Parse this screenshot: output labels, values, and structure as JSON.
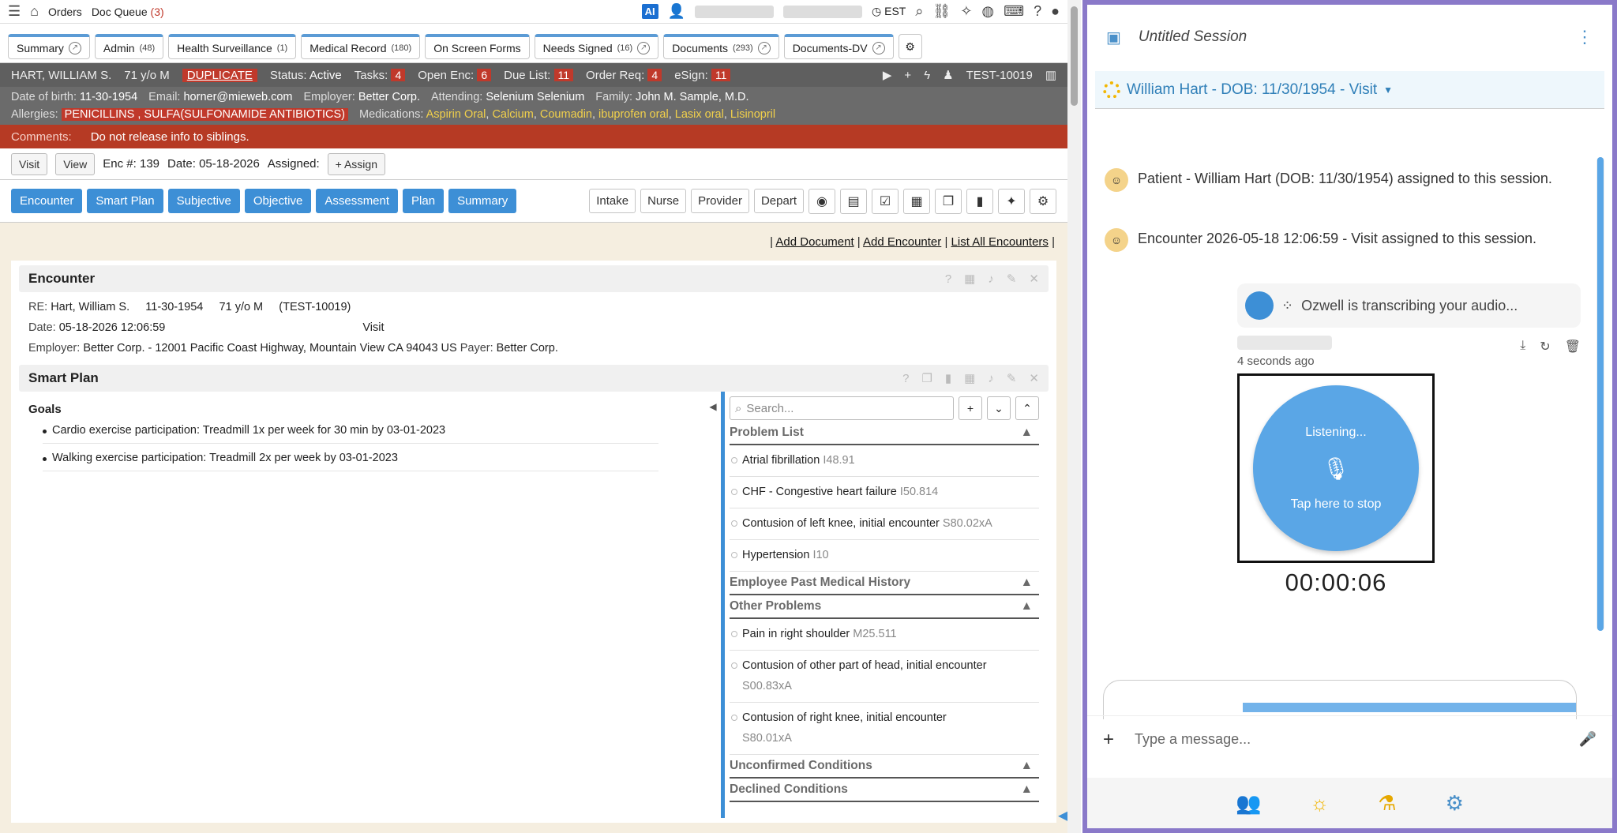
{
  "topbar": {
    "orders": "Orders",
    "doc_queue": "Doc Queue",
    "doc_queue_count": "(3)",
    "ai": "AI",
    "tz": "EST"
  },
  "tabs": [
    {
      "label": "Summary",
      "count": ""
    },
    {
      "label": "Admin",
      "count": "(48)"
    },
    {
      "label": "Health Surveillance",
      "count": "(1)"
    },
    {
      "label": "Medical Record",
      "count": "(180)"
    },
    {
      "label": "On Screen Forms",
      "count": ""
    },
    {
      "label": "Needs Signed",
      "count": "(16)"
    },
    {
      "label": "Documents",
      "count": "(293)"
    },
    {
      "label": "Documents-DV",
      "count": ""
    }
  ],
  "patient": {
    "name": "HART, WILLIAM S.",
    "age": "71 y/o M",
    "duplicate": "DUPLICATE",
    "status_lbl": "Status:",
    "status": "Active",
    "tasks_lbl": "Tasks:",
    "tasks": "4",
    "openenc_lbl": "Open Enc:",
    "openenc": "6",
    "due_lbl": "Due List:",
    "due": "11",
    "orderreq_lbl": "Order Req:",
    "orderreq": "4",
    "esign_lbl": "eSign:",
    "esign": "11",
    "id": "TEST-10019",
    "dob_lbl": "Date of birth:",
    "dob": "11-30-1954",
    "email_lbl": "Email:",
    "email": "horner@mieweb.com",
    "employer_lbl": "Employer:",
    "employer": "Better Corp.",
    "attending_lbl": "Attending:",
    "attending": "Selenium Selenium",
    "family_lbl": "Family:",
    "family": "John M. Sample, M.D.",
    "allergies_lbl": "Allergies:",
    "allergies": "PENICILLINS , SULFA(SULFONAMIDE ANTIBIOTICS)",
    "meds_lbl": "Medications:",
    "meds": [
      "Aspirin Oral",
      "Calcium",
      "Coumadin",
      "ibuprofen oral",
      "Lasix oral",
      "Lisinopril"
    ]
  },
  "comments": {
    "label": "Comments:",
    "text": "Do not release info to siblings."
  },
  "visitbar": {
    "visit": "Visit",
    "view": "View",
    "enc_lbl": "Enc #:",
    "enc": "139",
    "date_lbl": "Date:",
    "date": "05-18-2026",
    "assigned_lbl": "Assigned:",
    "assign": "Assign"
  },
  "nav": {
    "left": [
      "Encounter",
      "Smart Plan",
      "Subjective",
      "Objective",
      "Assessment",
      "Plan",
      "Summary"
    ],
    "right": [
      "Intake",
      "Nurse",
      "Provider",
      "Depart"
    ]
  },
  "links": {
    "add_document": "Add Document",
    "add_encounter": "Add Encounter",
    "list_all": "List All Encounters"
  },
  "encounter": {
    "title": "Encounter",
    "re_lbl": "RE:",
    "re": "Hart, William S.",
    "re_dob": "11-30-1954",
    "re_age": "71 y/o M",
    "re_id": "(TEST-10019)",
    "date_lbl": "Date:",
    "date": "05-18-2026 12:06:59",
    "type": "Visit",
    "employer_lbl": "Employer:",
    "employer": "Better Corp. - 12001 Pacific Coast Highway, Mountain View CA 94043 US",
    "payer_lbl": "Payer:",
    "payer": "Better Corp."
  },
  "smartplan": {
    "title": "Smart Plan",
    "goals_title": "Goals",
    "goals": [
      "Cardio exercise participation: Treadmill 1x per week for 30 min by 03-01-2023",
      "Walking exercise participation: Treadmill 2x per week by 03-01-2023"
    ]
  },
  "problems": {
    "search_placeholder": "Search...",
    "problem_list": {
      "title": "Problem List",
      "items": [
        {
          "name": "Atrial fibrillation",
          "code": "I48.91"
        },
        {
          "name": "CHF - Congestive heart failure",
          "code": "I50.814"
        },
        {
          "name": "Contusion of left knee, initial encounter",
          "code": "S80.02xA"
        },
        {
          "name": "Hypertension",
          "code": "I10"
        }
      ]
    },
    "past": {
      "title": "Employee Past Medical History"
    },
    "other": {
      "title": "Other Problems",
      "items": [
        {
          "name": "Pain in right shoulder",
          "code": "M25.511"
        },
        {
          "name": "Contusion of other part of head, initial encounter",
          "code": "S00.83xA"
        },
        {
          "name": "Contusion of right knee, initial encounter",
          "code": "S80.01xA"
        }
      ]
    },
    "unconfirmed": {
      "title": "Unconfirmed Conditions"
    },
    "declined": {
      "title": "Declined Conditions"
    }
  },
  "session": {
    "title": "Untitled Session",
    "patient": "William Hart - DOB: 11/30/1954 - Visit",
    "messages": [
      "Patient - William Hart (DOB: 11/30/1954) assigned to this session.",
      "Encounter 2026-05-18 12:06:59 - Visit assigned to this session."
    ],
    "transcribing": "Ozwell is transcribing your audio...",
    "ago": "4 seconds ago",
    "listening": "Listening...",
    "tap": "Tap here to stop",
    "timer": "00:00:06",
    "input_placeholder": "Type a message..."
  },
  "colors": {
    "accent": "#3d8fd6",
    "alert": "#c0392b",
    "frame": "#8a79c9"
  }
}
